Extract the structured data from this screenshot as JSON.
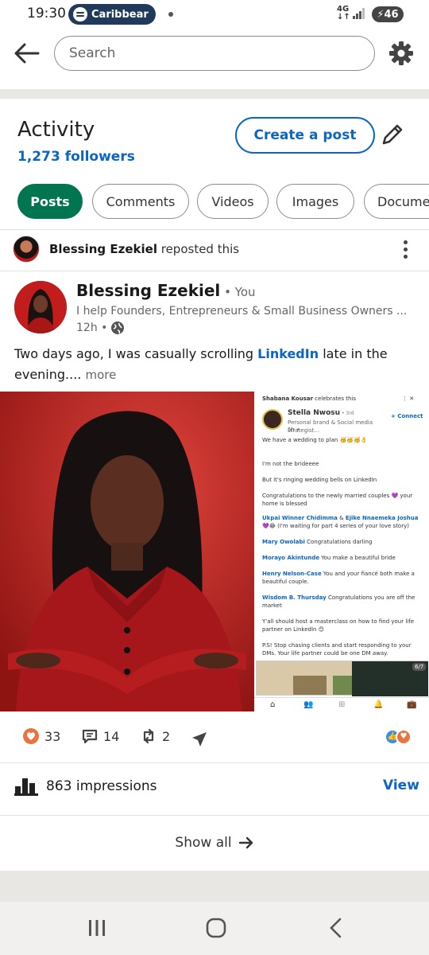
{
  "status_bar": {
    "time": "19:30",
    "media_pill_text": "Caribbear",
    "network": "4G",
    "battery": "46"
  },
  "header": {
    "search_placeholder": "Search"
  },
  "activity": {
    "title": "Activity",
    "followers": "1,273 followers",
    "create_post_label": "Create a post",
    "tabs": [
      {
        "label": "Posts",
        "active": true
      },
      {
        "label": "Comments",
        "active": false
      },
      {
        "label": "Videos",
        "active": false
      },
      {
        "label": "Images",
        "active": false
      },
      {
        "label": "Docume",
        "active": false
      }
    ]
  },
  "post": {
    "repost_name": "Blessing Ezekiel",
    "repost_suffix": " reposted this",
    "author_name": "Blessing Ezekiel",
    "author_tag": " • You",
    "author_headline": "I help Founders, Entrepreneurs & Small Business Owners ...",
    "time": "12h •",
    "text_before": "Two days ago, I was casually scrolling ",
    "text_link": "LinkedIn",
    "text_after": " late in the evening.... ",
    "more_label": "more",
    "embedded": {
      "celebrator": "Shabana Kousar",
      "celebrator_suffix": " celebrates this",
      "name": "Stella Nwosu",
      "degree": " • 3rd",
      "headline": "Personal brand & Social media strategist...",
      "time": "5h •",
      "connect": "Connect",
      "lines": [
        "We have a wedding to plan 🥳🥳🥳👌",
        "I'm not the brideeee",
        "But it's ringing wedding bells on LinkedIn",
        "Congratulations to the newly married couples 💜 your home is blessed",
        "Ukpai Winner Chidimma",
        " & ",
        "Ejike Nnaemeka Joshua",
        " 💜😂 (I'm waiting for part 4 series of your love story)",
        "Mary Owolabi",
        " Congratulations darling",
        "Morayo Akintunde",
        " You make a beautiful bride",
        "Henry Nelson-Case",
        " You and your fiancé both make a beautiful couple.",
        "Wisdom B. Thursday",
        " Congratulations you are off the market",
        "Y'all should host a masterclass on how to find your life partner on LinkedIn 😊",
        "P.S! Stop chasing clients and start responding to your DMs. Your life partner could be one DM away."
      ],
      "counter": "6/7"
    }
  },
  "engagement": {
    "likes": "33",
    "comments": "14",
    "reposts": "2",
    "impressions": "863 impressions",
    "view_label": "View",
    "show_all": "Show all"
  },
  "colors": {
    "linkedin_blue": "#0a66c2",
    "active_tab_green": "#01754f"
  }
}
